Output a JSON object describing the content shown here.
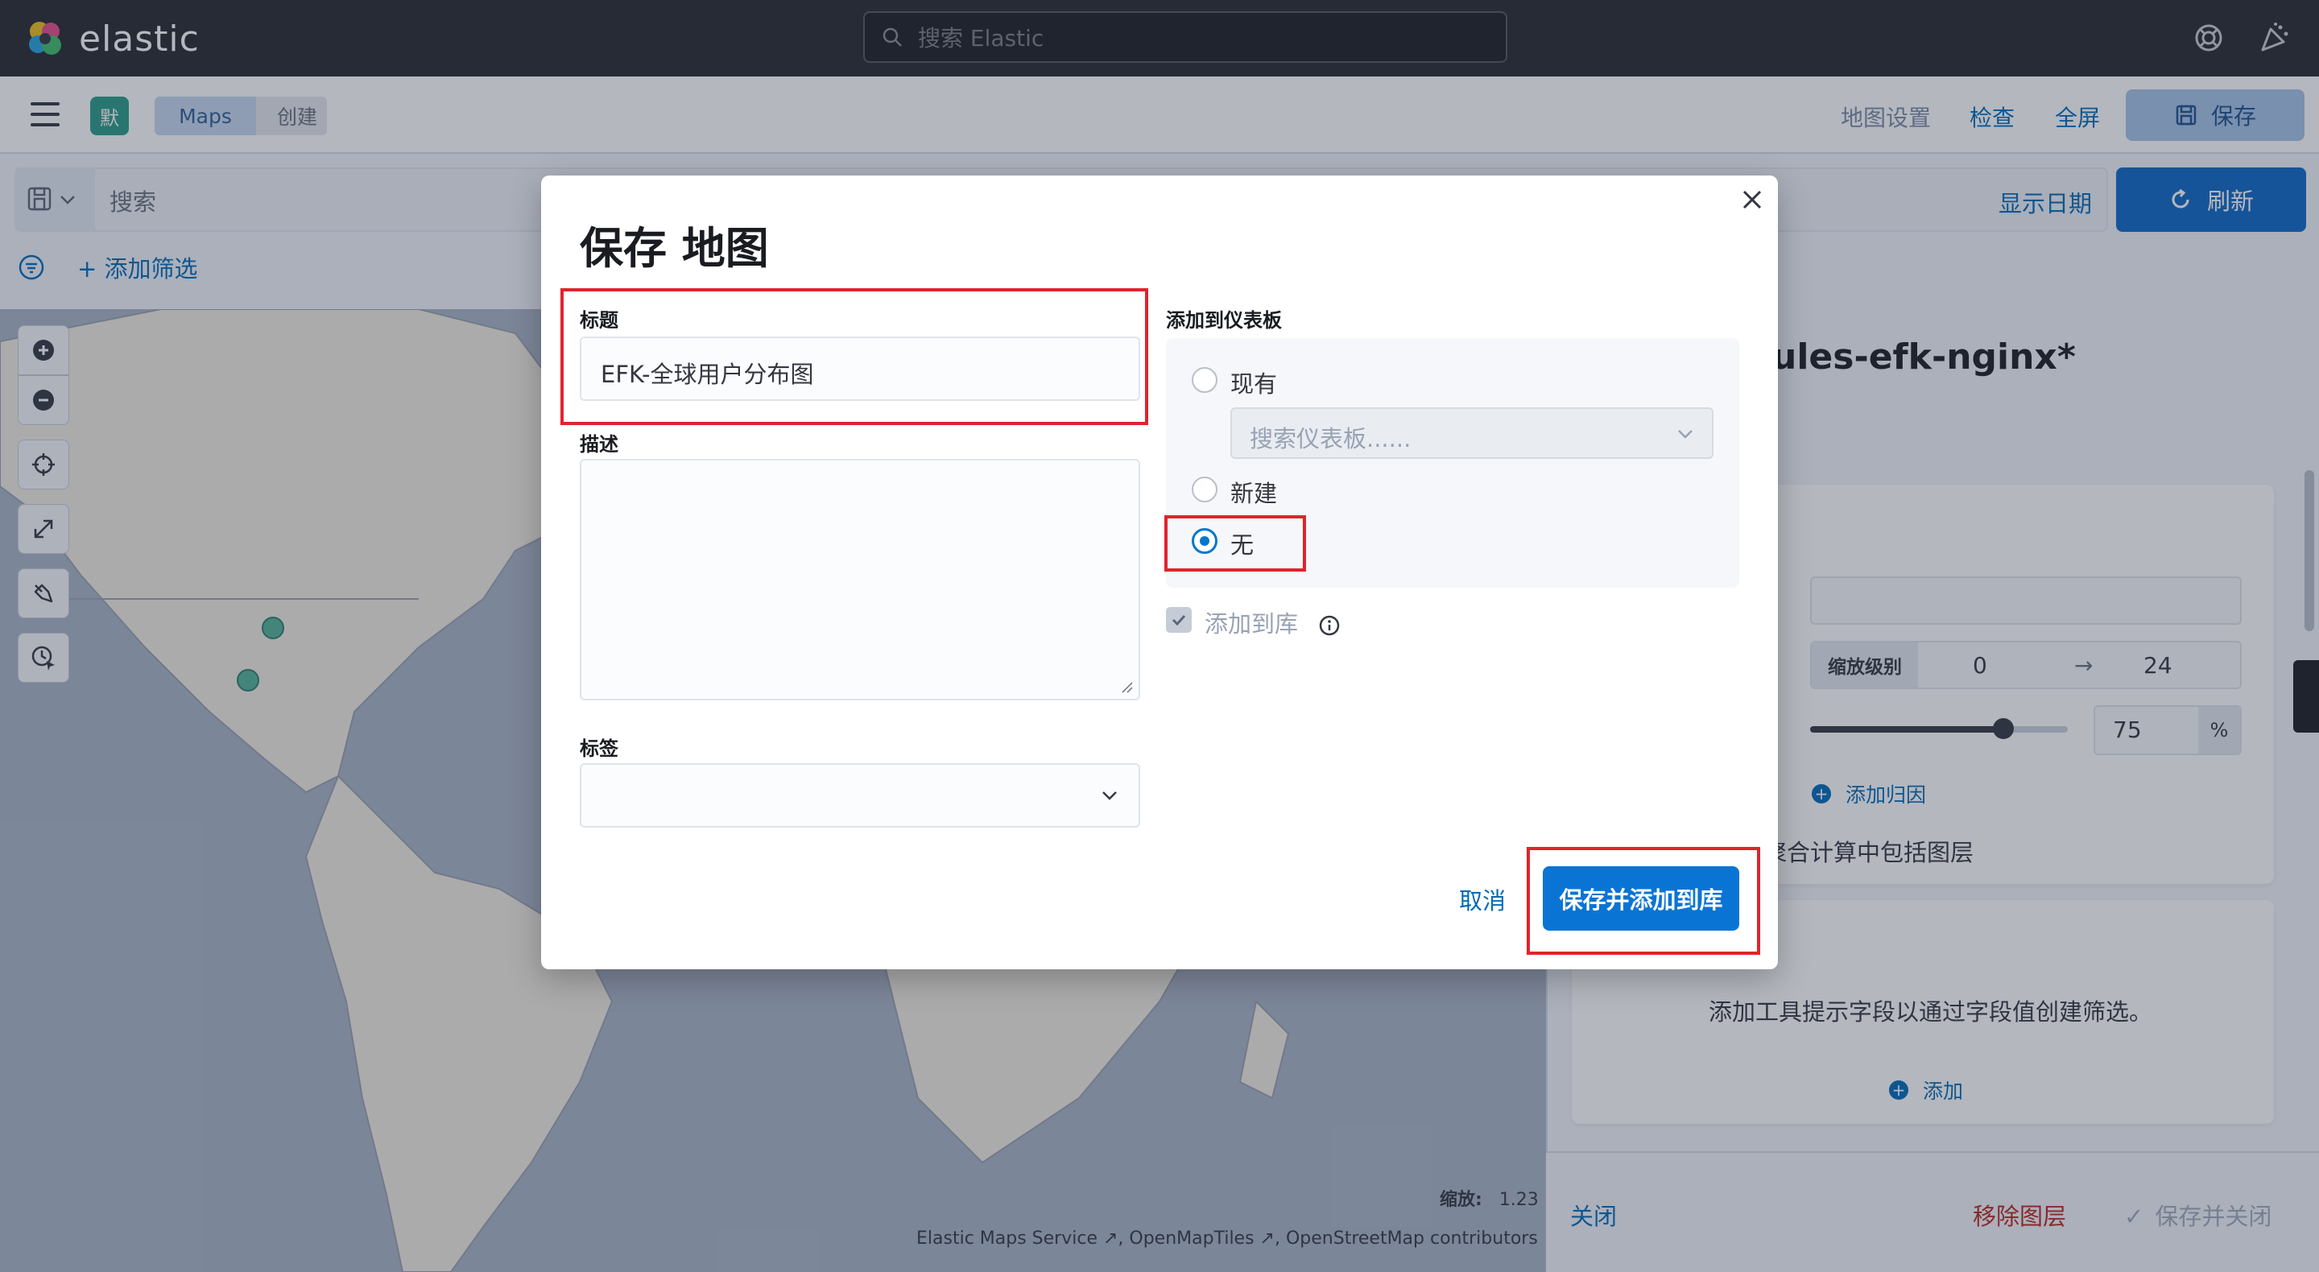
{
  "header": {
    "brand": "elastic",
    "search_placeholder": "搜索 Elastic"
  },
  "nav": {
    "space_initial": "默",
    "breadcrumbs": [
      "Maps",
      "创建"
    ],
    "links": [
      "地图设置",
      "检查",
      "全屏"
    ],
    "save_label": "保存"
  },
  "query": {
    "placeholder": "搜索",
    "show_dates": "显示日期",
    "refresh": "刷新",
    "add_filter": "+ 添加筛选"
  },
  "map": {
    "zoom_label": "缩放:",
    "zoom_value": "1.23",
    "attribution": "Elastic Maps Service ↗, OpenMapTiles ↗, OpenStreetMap contributors ↗"
  },
  "panel": {
    "layer_title": "ules-efk-nginx*",
    "zoom_levels_label": "缩放级别",
    "zoom_min": "0",
    "zoom_arrow": "→",
    "zoom_max": "24",
    "opacity_value": "75",
    "opacity_unit": "%",
    "opacity_level": 0.75,
    "add_join": "添加归因",
    "include_text": "聚合计算中包括图层",
    "tooltip_text": "添加工具提示字段以通过字段值创建筛选。",
    "add": "添加",
    "close": "关闭",
    "remove_layer": "移除图层",
    "save_and_close": "保存并关闭"
  },
  "modal": {
    "title": "保存 地图",
    "title_label": "标题",
    "title_value": "EFK-全球用户分布图",
    "description_label": "描述",
    "tags_label": "标签",
    "dashboard_label": "添加到仪表板",
    "radio_existing": "现有",
    "dashboard_placeholder": "搜索仪表板......",
    "radio_new": "新建",
    "radio_none": "无",
    "selected_option": "无",
    "add_to_library": "添加到库",
    "cancel": "取消",
    "save_add_library": "保存并添加到库"
  },
  "colors": {
    "accent": "#0a74d4",
    "highlight": "#e0242c",
    "dark_header": "#25282f"
  }
}
